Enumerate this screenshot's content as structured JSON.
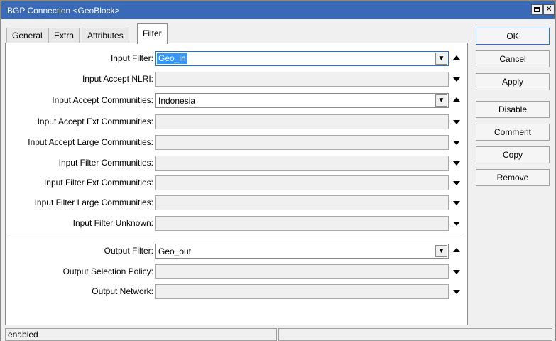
{
  "window": {
    "title": "BGP Connection <GeoBlock>",
    "minimize_icon": "minimize-icon",
    "close_label": "✕",
    "accent_color": "#3a69b8"
  },
  "tabs": [
    {
      "label": "General",
      "active": false
    },
    {
      "label": "Extra",
      "active": false
    },
    {
      "label": "Attributes",
      "active": false
    },
    {
      "label": "Filter",
      "active": true
    }
  ],
  "fields": [
    {
      "label": "Input Filter:",
      "value": "Geo_in",
      "selected": true,
      "has_dropdown": true,
      "arrow": "up"
    },
    {
      "label": "Input Accept NLRI:",
      "value": "",
      "has_dropdown": false,
      "arrow": "down"
    },
    {
      "label": "Input Accept Communities:",
      "value": "Indonesia",
      "has_dropdown": true,
      "arrow": "up"
    },
    {
      "label": "Input Accept Ext Communities:",
      "value": "",
      "has_dropdown": false,
      "arrow": "down"
    },
    {
      "label": "Input Accept Large Communities:",
      "value": "",
      "has_dropdown": false,
      "arrow": "down"
    },
    {
      "label": "Input Filter Communities:",
      "value": "",
      "has_dropdown": false,
      "arrow": "down"
    },
    {
      "label": "Input Filter Ext Communities:",
      "value": "",
      "has_dropdown": false,
      "arrow": "down"
    },
    {
      "label": "Input Filter Large Communities:",
      "value": "",
      "has_dropdown": false,
      "arrow": "down"
    },
    {
      "label": "Input Filter Unknown:",
      "value": "",
      "has_dropdown": false,
      "arrow": "down"
    },
    {
      "label": "Output Filter:",
      "value": "Geo_out",
      "has_dropdown": true,
      "arrow": "up"
    },
    {
      "label": "Output Selection Policy:",
      "value": "",
      "has_dropdown": false,
      "arrow": "down"
    },
    {
      "label": "Output Network:",
      "value": "",
      "has_dropdown": false,
      "arrow": "down"
    }
  ],
  "buttons": {
    "ok": "OK",
    "cancel": "Cancel",
    "apply": "Apply",
    "disable": "Disable",
    "comment": "Comment",
    "copy": "Copy",
    "remove": "Remove"
  },
  "status": {
    "left": "enabled",
    "right": ""
  }
}
